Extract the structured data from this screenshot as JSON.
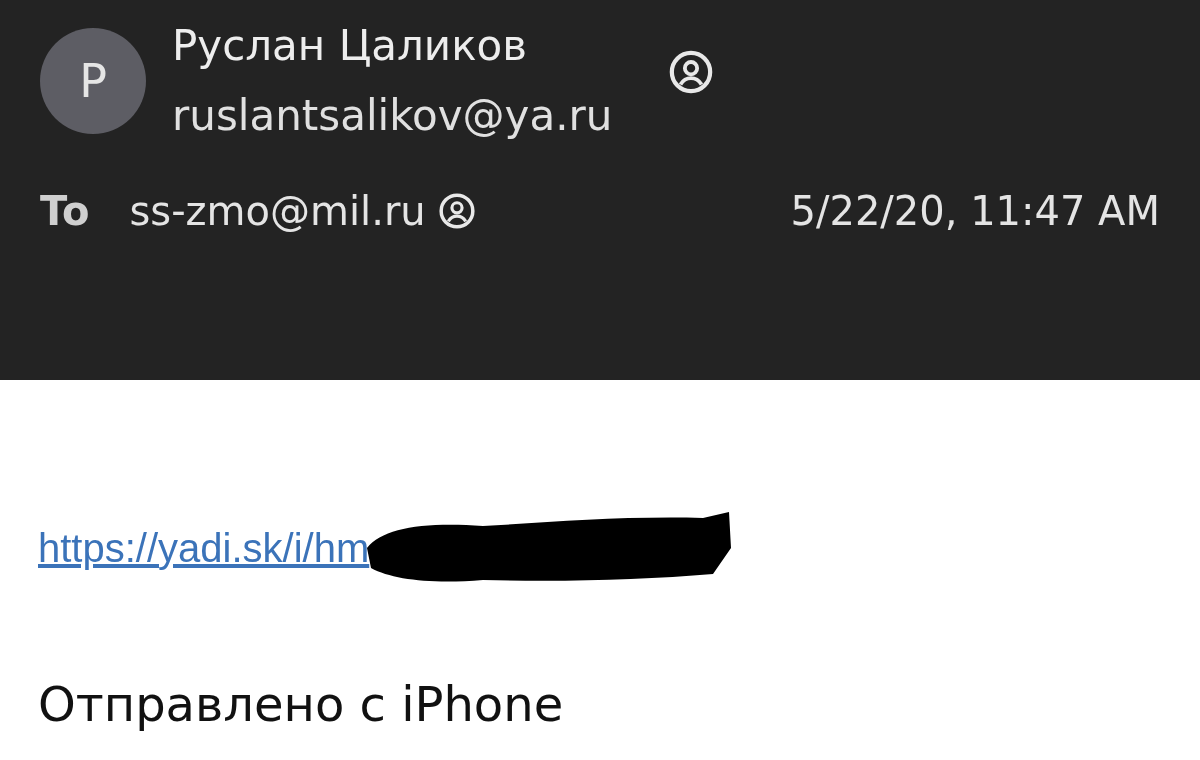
{
  "sender": {
    "avatar_letter": "Р",
    "name": "Руслан Цаликов",
    "email": "ruslantsalikov@ya.ru"
  },
  "recipient": {
    "label": "To",
    "address": "ss-zmo@mil.ru"
  },
  "date": "5/22/20, 11:47 AM",
  "body": {
    "link": "https://yadi.sk/i/hm",
    "redacted": true,
    "signature": "Отправлено с iPhone"
  }
}
